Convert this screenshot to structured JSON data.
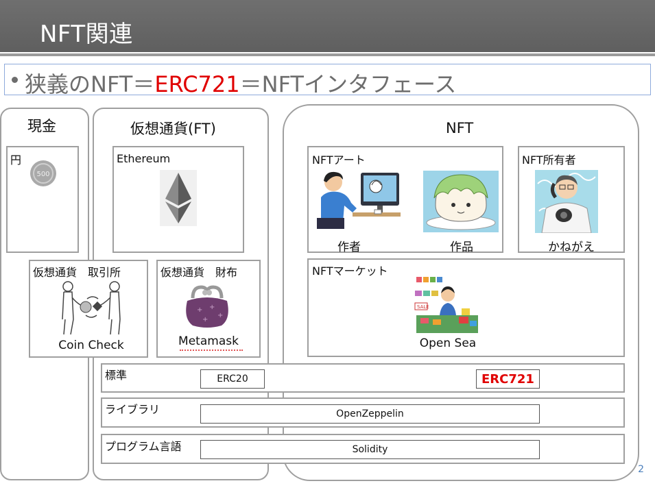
{
  "slide": {
    "title": "NFT関連",
    "bullet": {
      "prefix": "狭義のNFT＝",
      "highlight": "ERC721",
      "suffix": "＝NFTインタフェース",
      "highlight_color": "#e00000"
    },
    "page_number": "2"
  },
  "groups": {
    "cash": {
      "label": "現金"
    },
    "crypto": {
      "label": "仮想通貨(FT)"
    },
    "nft": {
      "label": "NFT"
    }
  },
  "panels": {
    "yen": {
      "label": "円",
      "icon": "coin-icon"
    },
    "ethereum": {
      "label": "Ethereum",
      "icon": "ethereum-icon"
    },
    "exchange": {
      "label": "仮想通貨　取引所",
      "caption": "Coin Check",
      "icon": "exchange-illustration"
    },
    "wallet": {
      "label": "仮想通貨　財布",
      "caption": "Metamask",
      "icon": "purse-icon"
    },
    "nft_art": {
      "label": "NFTアート",
      "creator_caption": "作者",
      "work_caption": "作品"
    },
    "nft_owner": {
      "label": "NFT所有者",
      "caption": "かねがえ"
    },
    "nft_market": {
      "label": "NFTマーケット",
      "caption": "Open Sea"
    }
  },
  "layers": [
    {
      "label": "標準",
      "boxes": [
        {
          "text": "ERC20"
        },
        {
          "text": "ERC721"
        }
      ]
    },
    {
      "label": "ライブラリ",
      "boxes": [
        {
          "text": "OpenZeppelin"
        }
      ]
    },
    {
      "label": "プログラム言語",
      "boxes": [
        {
          "text": "Solidity"
        }
      ]
    }
  ]
}
